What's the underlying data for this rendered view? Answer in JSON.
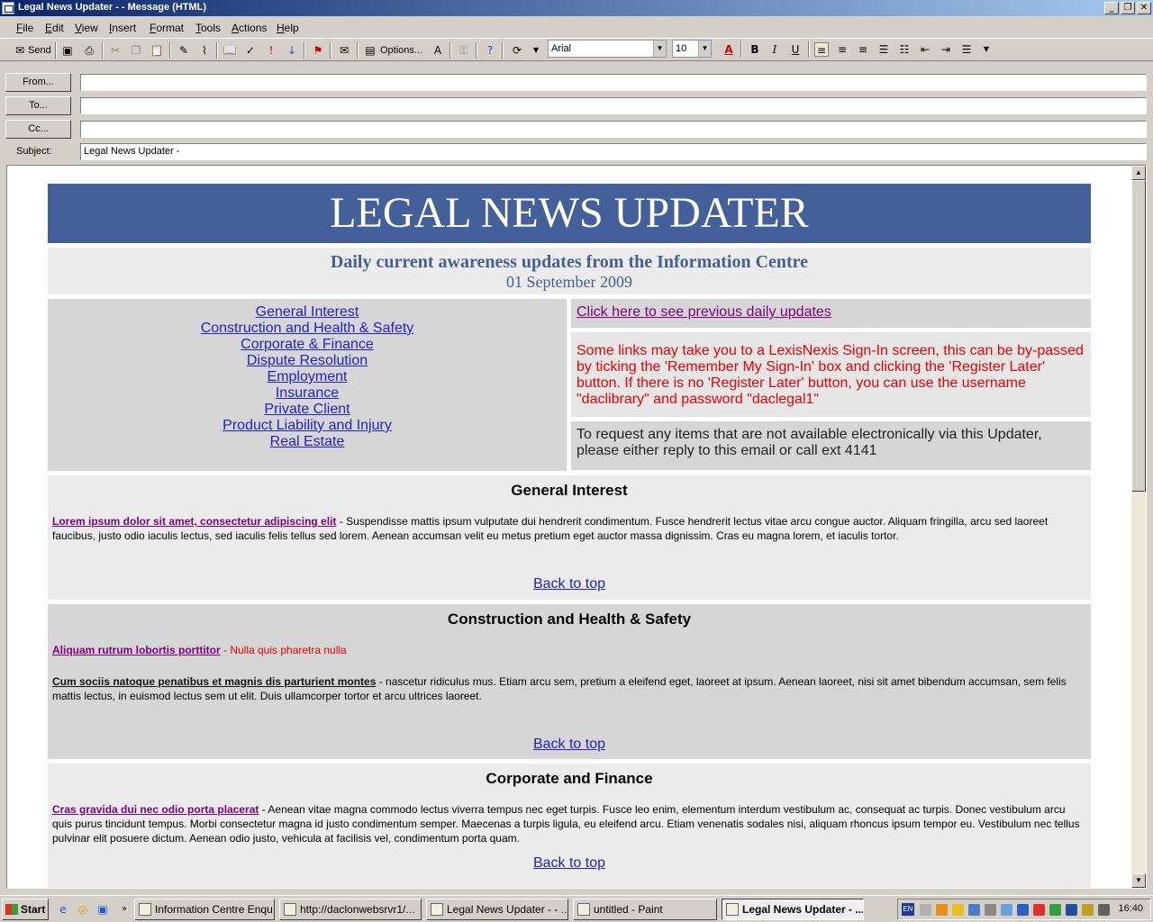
{
  "window": {
    "title": "Legal News Updater -  - Message (HTML)"
  },
  "menu": [
    "File",
    "Edit",
    "View",
    "Insert",
    "Format",
    "Tools",
    "Actions",
    "Help"
  ],
  "toolbar": {
    "send_label": "Send",
    "options_label": "Options...",
    "font_name": "Arial",
    "font_size": "10"
  },
  "header": {
    "from_label": "From...",
    "to_label": "To...",
    "cc_label": "Cc...",
    "subject_label": "Subject:",
    "from_value": "",
    "to_value": "",
    "cc_value": "",
    "subject_value": "Legal News Updater -"
  },
  "newsletter": {
    "banner_title": "LEGAL NEWS UPDATER",
    "subtitle": "Daily current awareness updates from the Information Centre",
    "date": "01 September 2009",
    "nav": [
      "General Interest",
      "Construction and Health & Safety",
      "Corporate & Finance",
      "Dispute Resolution",
      "Employment",
      "Insurance",
      "Private Client",
      "Product Liability and Injury",
      "Real Estate"
    ],
    "previous_link": "Click here to see previous daily updates",
    "warning": "Some links may take you to a LexisNexis Sign-In screen, this can be by-passed by ticking the 'Remember My Sign-In' box and clicking the 'Register Later' button. If there is no 'Register Later' button, you can use the username \"daclibrary\" and password \"daclegal1\"",
    "request": "To request any items that are not available electronically via this Updater, please either reply to this email or call ext 4141",
    "back_to_top": "Back to top",
    "sections": {
      "general": {
        "heading": "General Interest",
        "a1_title": "Lorem ipsum dolor sit amet, consectetur adipiscing elit",
        "a1_text": " - Suspendisse mattis ipsum vulputate dui hendrerit condimentum. Fusce hendrerit lectus vitae arcu congue auctor. Aliquam fringilla, arcu sed laoreet faucibus, justo odio iaculis lectus, sed iaculis felis tellus sed lorem. Aenean accumsan velit eu metus pretium eget auctor massa dignissim. Cras eu magna lorem, et iaculis tortor."
      },
      "construction": {
        "heading": "Construction and Health & Safety",
        "a1_title": "Aliquam rutrum lobortis porttitor",
        "a1_text": " - Nulla quis pharetra nulla",
        "a2_title": "Cum sociis natoque penatibus et magnis dis parturient montes",
        "a2_text": " - nascetur ridiculus mus. Etiam arcu sem, pretium a eleifend eget, laoreet at ipsum. Aenean laoreet, nisi sit amet bibendum accumsan, sem felis mattis lectus, in euismod lectus sem ut elit. Duis ullamcorper tortor et arcu ultrices laoreet."
      },
      "corporate": {
        "heading": "Corporate and Finance",
        "a1_title": "Cras gravida dui nec odio porta placerat",
        "a1_text": " - Aenean vitae magna commodo lectus viverra tempus nec eget turpis. Fusce leo enim, elementum interdum vestibulum ac, consequat ac turpis. Donec vestibulum arcu quis purus tincidunt tempus. Morbi consectetur magna id justo condimentum semper. Maecenas a turpis ligula, eu eleifend arcu. Etiam venenatis sodales nisi, aliquam rhoncus ipsum tempor eu. Vestibulum nec tellus pulvinar elit posuere dictum. Aenean odio justo, vehicula at facilisis vel, condimentum porta quam."
      }
    }
  },
  "taskbar": {
    "start_label": "Start",
    "tasks": [
      "Information Centre Enqu...",
      "http://daclonwebsrvr1/...",
      "Legal News Updater - - ...",
      "untitled - Paint",
      "Legal News Updater - ..."
    ],
    "lang": "EN",
    "clock": "16:40"
  },
  "colors": {
    "banner_bg": "#43609a",
    "link": "#2222cc",
    "visited": "#800080",
    "warning": "#ee0000"
  }
}
